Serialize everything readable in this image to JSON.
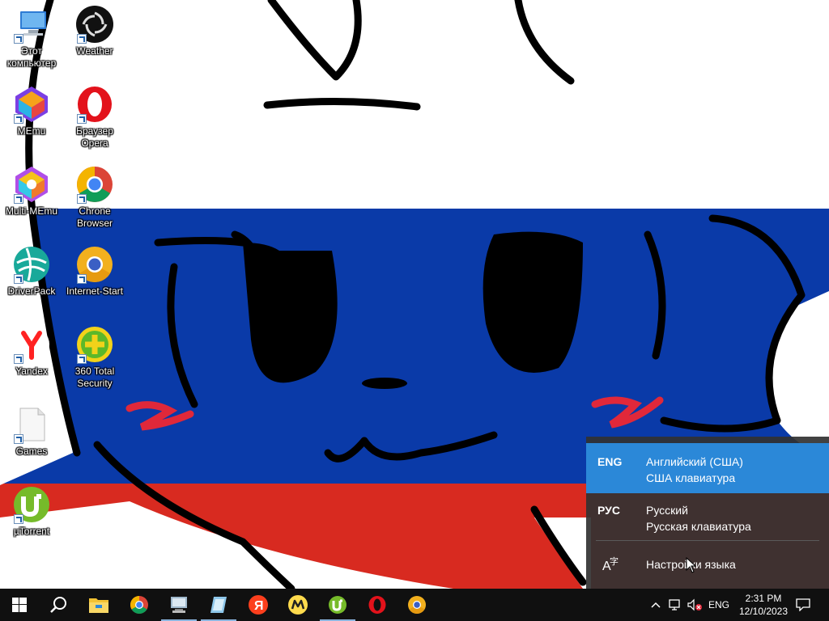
{
  "desktop": {
    "icons": [
      {
        "label": "Этот\nкомпьютер",
        "icon": "this-pc-icon"
      },
      {
        "label": "Weather",
        "icon": "weather-icon"
      },
      {
        "label": "MEmu",
        "icon": "memu-icon"
      },
      {
        "label": "Браузер\nOpera",
        "icon": "opera-icon"
      },
      {
        "label": "Multi-MEmu",
        "icon": "multi-memu-icon"
      },
      {
        "label": "Chrone\nBrowser",
        "icon": "chrome-icon"
      },
      {
        "label": "DriverPack",
        "icon": "driverpack-icon"
      },
      {
        "label": "Internet-Start",
        "icon": "internet-start-icon"
      },
      {
        "label": "Yandex",
        "icon": "yandex-icon"
      },
      {
        "label": "360 Total\nSecurity",
        "icon": "360-total-security-icon"
      },
      {
        "label": "Games",
        "icon": "file-icon"
      },
      {
        "label": "µTorrent",
        "icon": "utorrent-icon"
      }
    ]
  },
  "language_flyout": {
    "items": [
      {
        "code": "ENG",
        "name": "Английский (США)",
        "keyboard": "США клавиатура",
        "selected": true
      },
      {
        "code": "РУС",
        "name": "Русский",
        "keyboard": "Русская клавиатура",
        "selected": false
      }
    ],
    "settings_label": "Настройки языка"
  },
  "taskbar": {
    "pinned": [
      "start-icon",
      "search-icon",
      "file-explorer-icon",
      "chrome-icon",
      "this-pc-icon",
      "notepad-icon",
      "yandex-icon",
      "yandex-market-icon",
      "utorrent-icon",
      "opera-icon",
      "chrome-icon"
    ],
    "tray": {
      "input_indicator": "ENG",
      "time": "2:31 PM",
      "date": "12/10/2023"
    }
  },
  "colors": {
    "flag_white": "#ffffff",
    "flag_blue": "#0a3aa8",
    "flag_red": "#d82a20",
    "flyout_selected": "#2b88d8",
    "taskbar": "#101010"
  }
}
